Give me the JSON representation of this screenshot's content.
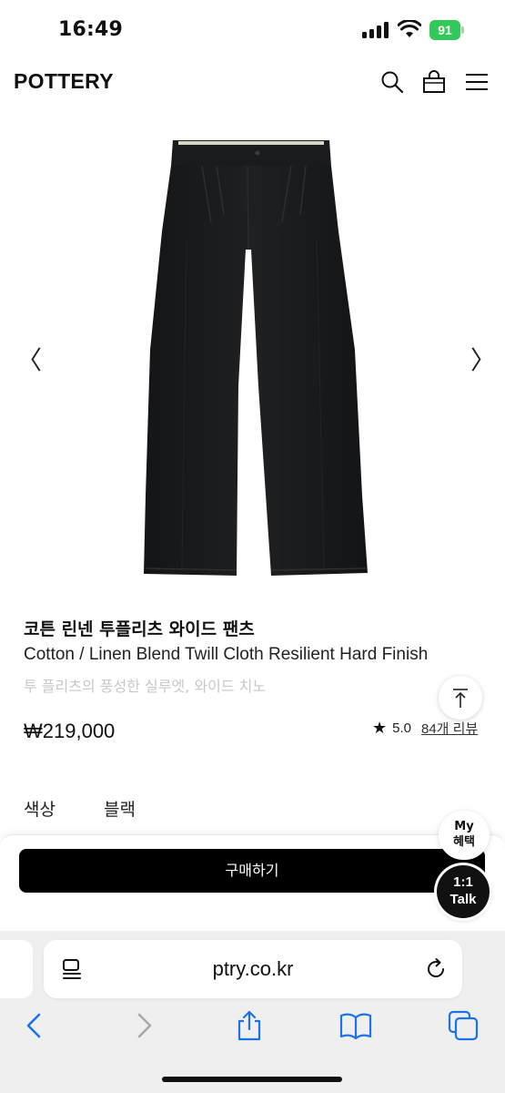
{
  "status_bar": {
    "time": "16:49",
    "battery_level": "91"
  },
  "header": {
    "logo": "POTTERY",
    "icons": [
      "search-icon",
      "shopping-bag-icon",
      "menu-icon"
    ]
  },
  "gallery": {
    "prev_arrow": "〈",
    "next_arrow": "〉"
  },
  "product": {
    "name_ko": "코튼 린넨 투플리츠 와이드 팬츠",
    "name_en": "Cotton / Linen Blend Twill Cloth Resilient Hard Finish",
    "description": "투 플리츠의 풍성한 실루엣, 와이드 치노",
    "price": "₩219,000",
    "rating": "5.0",
    "review_count": "84개 리뷰"
  },
  "options": {
    "color_label": "색상",
    "color_value": "블랙"
  },
  "purchase": {
    "buy_label": "구매하기"
  },
  "floating": {
    "my_benefit_line1": "My",
    "my_benefit_line2": "혜택",
    "talk_line1": "1:1",
    "talk_line2": "Talk"
  },
  "browser": {
    "url": "ptry.co.kr"
  },
  "colors": {
    "accent": "#000000",
    "battery": "#34c759",
    "subtitle": "#c8c8c8"
  }
}
